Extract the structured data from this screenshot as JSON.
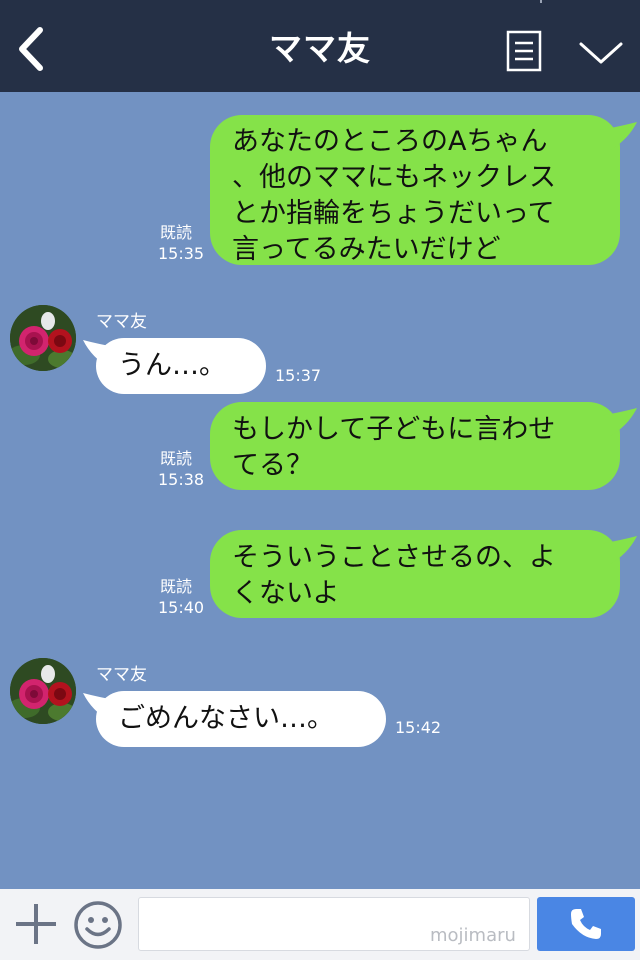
{
  "header": {
    "title": "ママ友"
  },
  "messages": [
    {
      "text": "あなたのところのAちゃん\n、他のママにもネックレス\nとか指輪をちょうだいって\n言ってるみたいだけど",
      "read": "既読",
      "time": "15:35"
    },
    {
      "sender": "ママ友",
      "text": "うん…。",
      "time": "15:37"
    },
    {
      "text": "もしかして子どもに言わせ\nてる？",
      "read": "既読",
      "time": "15:38"
    },
    {
      "text": "そういうことさせるの、よ\nくないよ",
      "read": "既読",
      "time": "15:40"
    },
    {
      "sender": "ママ友",
      "text": "ごめんなさい…。",
      "time": "15:42"
    }
  ],
  "composer": {
    "watermark": "mojimaru"
  },
  "colors": {
    "background": "#7292c2",
    "header": "#253046",
    "outgoing_bubble": "#85e249",
    "incoming_bubble": "#ffffff",
    "call_button": "#4a86e4"
  },
  "icons": [
    "back-arrow-icon",
    "menu-icon",
    "chevron-down-icon",
    "plus-icon",
    "smile-icon",
    "phone-icon"
  ]
}
